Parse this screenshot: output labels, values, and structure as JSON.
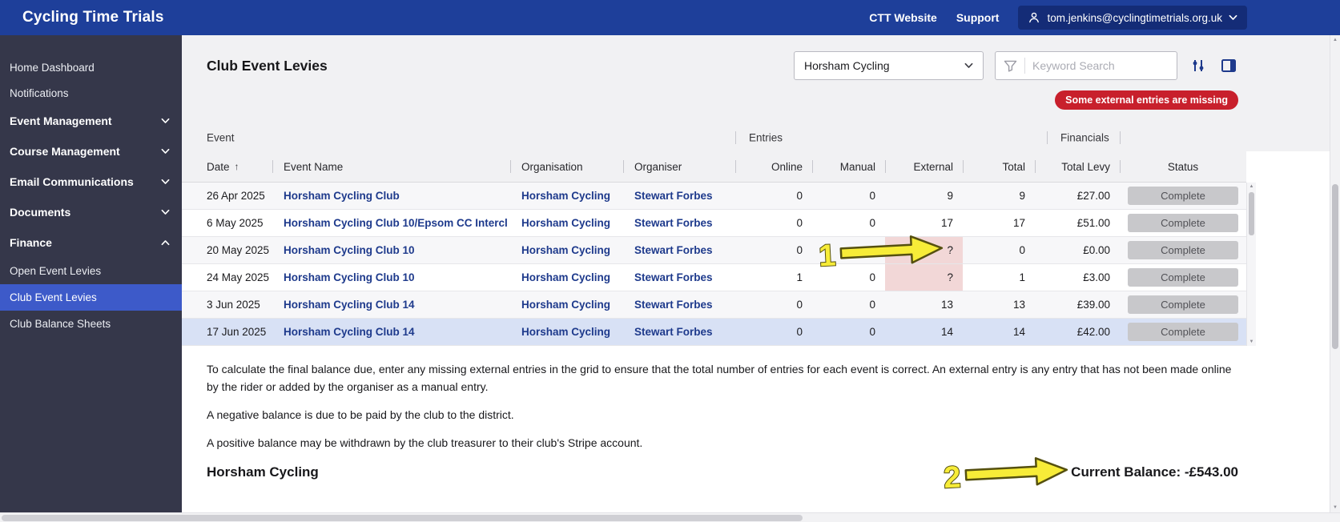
{
  "topbar": {
    "logo": "Cycling Time Trials",
    "links": [
      {
        "label": "CTT Website"
      },
      {
        "label": "Support"
      }
    ],
    "user_email": "tom.jenkins@cyclingtimetrials.org.uk"
  },
  "sidebar": {
    "items": [
      {
        "label": "Home Dashboard",
        "type": "link"
      },
      {
        "label": "Notifications",
        "type": "link"
      },
      {
        "label": "Event Management",
        "type": "section",
        "expanded": false
      },
      {
        "label": "Course Management",
        "type": "section",
        "expanded": false
      },
      {
        "label": "Email Communications",
        "type": "section",
        "expanded": false
      },
      {
        "label": "Documents",
        "type": "section",
        "expanded": false
      },
      {
        "label": "Finance",
        "type": "section",
        "expanded": true,
        "children": [
          {
            "label": "Open Event Levies",
            "active": false
          },
          {
            "label": "Club Event Levies",
            "active": true
          },
          {
            "label": "Club Balance Sheets",
            "active": false
          }
        ]
      }
    ]
  },
  "header": {
    "title": "Club Event Levies",
    "club_select": "Horsham Cycling",
    "search_placeholder": "Keyword Search",
    "warning_badge": "Some external entries are missing"
  },
  "table": {
    "group_headers": [
      "Event",
      "Entries",
      "Financials"
    ],
    "columns": [
      "Date",
      "Event Name",
      "Organisation",
      "Organiser",
      "Online",
      "Manual",
      "External",
      "Total",
      "Total Levy",
      "Status"
    ],
    "sort": {
      "column": "Date",
      "direction": "ascending"
    },
    "rows": [
      {
        "date": "26 Apr 2025",
        "event_name": "Horsham Cycling Club",
        "organisation": "Horsham Cycling",
        "organiser": "Stewart Forbes",
        "online": "0",
        "manual": "0",
        "external": "9",
        "total": "9",
        "total_levy": "£27.00",
        "status": "Complete",
        "external_missing": false,
        "highlighted": false
      },
      {
        "date": "6 May 2025",
        "event_name": "Horsham Cycling Club 10/Epsom CC Intercl",
        "organisation": "Horsham Cycling",
        "organiser": "Stewart Forbes",
        "online": "0",
        "manual": "0",
        "external": "17",
        "total": "17",
        "total_levy": "£51.00",
        "status": "Complete",
        "external_missing": false,
        "highlighted": false
      },
      {
        "date": "20 May 2025",
        "event_name": "Horsham Cycling Club 10",
        "organisation": "Horsham Cycling",
        "organiser": "Stewart Forbes",
        "online": "0",
        "manual": "0",
        "external": "?",
        "total": "0",
        "total_levy": "£0.00",
        "status": "Complete",
        "external_missing": true,
        "highlighted": false
      },
      {
        "date": "24 May 2025",
        "event_name": "Horsham Cycling Club 10",
        "organisation": "Horsham Cycling",
        "organiser": "Stewart Forbes",
        "online": "1",
        "manual": "0",
        "external": "?",
        "total": "1",
        "total_levy": "£3.00",
        "status": "Complete",
        "external_missing": true,
        "highlighted": false
      },
      {
        "date": "3 Jun 2025",
        "event_name": "Horsham Cycling Club 14",
        "organisation": "Horsham Cycling",
        "organiser": "Stewart Forbes",
        "online": "0",
        "manual": "0",
        "external": "13",
        "total": "13",
        "total_levy": "£39.00",
        "status": "Complete",
        "external_missing": false,
        "highlighted": false
      },
      {
        "date": "17 Jun 2025",
        "event_name": "Horsham Cycling Club 14",
        "organisation": "Horsham Cycling",
        "organiser": "Stewart Forbes",
        "online": "0",
        "manual": "0",
        "external": "14",
        "total": "14",
        "total_levy": "£42.00",
        "status": "Complete",
        "external_missing": false,
        "highlighted": true
      }
    ]
  },
  "footer": {
    "para1": "To calculate the final balance due, enter any missing external entries in the grid to ensure that the total number of entries for each event is correct. An external entry is any entry that has not been made online by the rider or added by the organiser as a manual entry.",
    "para2": "A negative balance is due to be paid by the club to the district.",
    "para3": "A positive balance may be withdrawn by the club treasurer to their club's Stripe account.",
    "club_name": "Horsham Cycling",
    "balance": "Current Balance: -£543.00"
  },
  "annotations": {
    "arrow1_label": "1",
    "arrow2_label": "2"
  },
  "colors": {
    "topbar_blue": "#1e3f9a",
    "sidebar_dark": "#35374a",
    "active_item_blue": "#3d5ac9",
    "link_navy": "#1e3a8c",
    "warning_red": "#c8202c",
    "missing_cell_pink": "#f2d7d7",
    "highlight_row_blue": "#d8e1f5",
    "annotation_yellow": "#f7ec38"
  }
}
